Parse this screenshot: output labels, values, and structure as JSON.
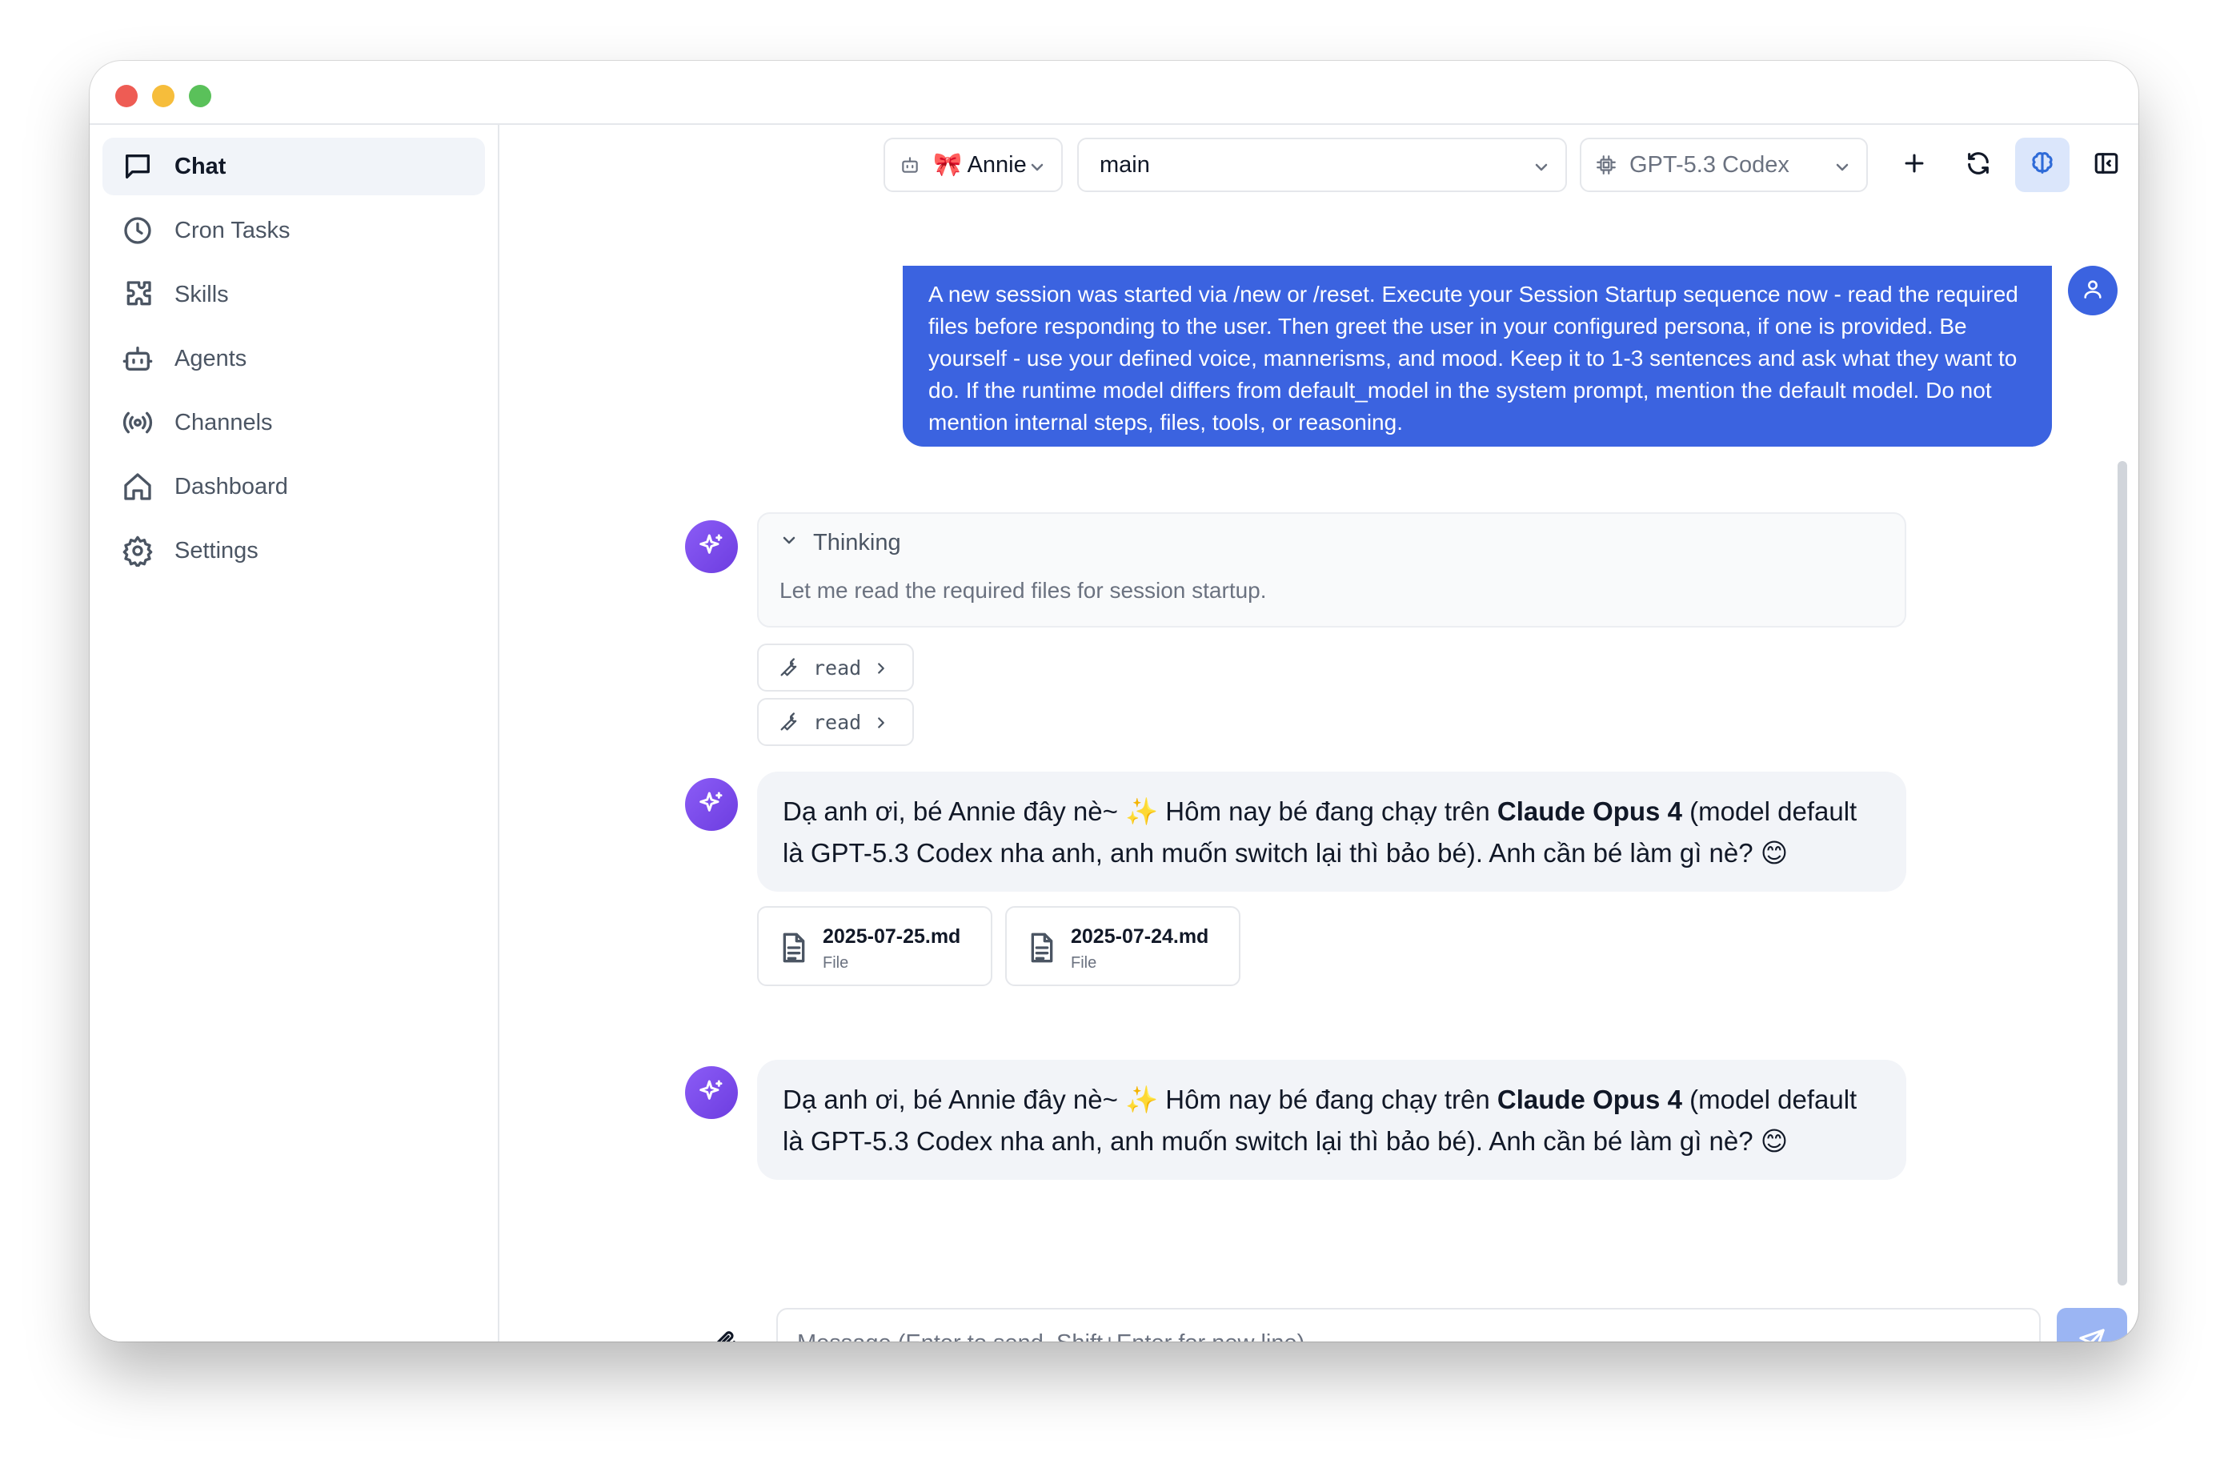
{
  "sidebar": {
    "items": [
      {
        "label": "Chat",
        "icon": "chat-icon",
        "active": true
      },
      {
        "label": "Cron Tasks",
        "icon": "clock-icon"
      },
      {
        "label": "Skills",
        "icon": "puzzle-icon"
      },
      {
        "label": "Agents",
        "icon": "bot-icon"
      },
      {
        "label": "Channels",
        "icon": "radio-icon"
      },
      {
        "label": "Dashboard",
        "icon": "home-icon"
      },
      {
        "label": "Settings",
        "icon": "gear-icon"
      }
    ],
    "collapse_icon": "chevron-left-icon"
  },
  "toolbar": {
    "agent": "🎀 Annie",
    "session": "main",
    "model": "GPT-5.3 Codex",
    "buttons": [
      "plus-icon",
      "refresh-icon",
      "brain-icon",
      "panel-icon"
    ]
  },
  "messages": {
    "user_text": "A new session was started via /new or /reset. Execute your Session Startup sequence now - read the required files before responding to the user. Then greet the user in your configured persona, if one is provided. Be yourself - use your defined voice, mannerisms, and mood. Keep it to 1-3 sentences and ask what they want to do. If the runtime model differs from default_model in the system prompt, mention the default model. Do not mention internal steps, files, tools, or reasoning.",
    "thinking_label": "Thinking",
    "thinking_text": "Let me read the required files for session startup.",
    "tools": [
      "read",
      "read"
    ],
    "reply": {
      "before": "Dạ anh ơi, bé Annie đây nè~ ✨ Hôm nay bé đang chạy trên ",
      "bold": "Claude Opus 4",
      "after": " (model default là GPT-5.3 Codex nha anh, anh muốn switch lại thì bảo bé). Anh cần bé làm gì nè? 😊"
    },
    "files": [
      {
        "name": "2025-07-25.md",
        "type": "File"
      },
      {
        "name": "2025-07-24.md",
        "type": "File"
      }
    ]
  },
  "composer": {
    "placeholder": "Message (Enter to send, Shift+Enter for new line)"
  },
  "colors": {
    "accent": "#3b63e0",
    "bot_avatar": "#7c4dea",
    "send_disabled": "#9bb5f3"
  }
}
